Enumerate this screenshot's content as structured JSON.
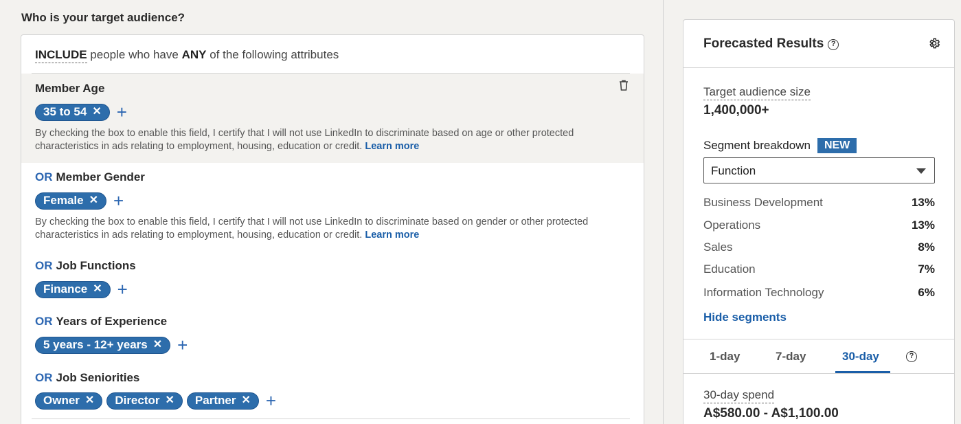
{
  "targeting": {
    "section_title": "Who is your target audience?",
    "include": {
      "keyword": "INCLUDE",
      "middle": "people who have",
      "any": "ANY",
      "end": "of the following attributes"
    },
    "or_label": "OR",
    "groups": [
      {
        "title": "Member Age",
        "pills": [
          "35 to 54"
        ],
        "disclaimer": "By checking the box to enable this field, I certify that I will not use LinkedIn to discriminate based on age or other protected characteristics in ads relating to employment, housing, education or credit.",
        "link": "Learn more"
      },
      {
        "title": "Member Gender",
        "pills": [
          "Female"
        ],
        "disclaimer": "By checking the box to enable this field, I certify that I will not use LinkedIn to discriminate based on gender or other protected characteristics in ads relating to employment, housing, education or credit.",
        "link": "Learn more"
      },
      {
        "title": "Job Functions",
        "pills": [
          "Finance"
        ]
      },
      {
        "title": "Years of Experience",
        "pills": [
          "5 years - 12+ years"
        ]
      },
      {
        "title": "Job Seniorities",
        "pills": [
          "Owner",
          "Director",
          "Partner"
        ]
      }
    ],
    "remove_glyph": "✕",
    "add_glyph": "+"
  },
  "forecast": {
    "title": "Forecasted Results",
    "help_glyph": "?",
    "audience_label": "Target audience size",
    "audience_value": "1,400,000+",
    "segment_label": "Segment breakdown",
    "new_badge": "NEW",
    "segment_select": "Function",
    "segments": [
      {
        "name": "Business Development",
        "pct": "13%"
      },
      {
        "name": "Operations",
        "pct": "13%"
      },
      {
        "name": "Sales",
        "pct": "8%"
      },
      {
        "name": "Education",
        "pct": "7%"
      },
      {
        "name": "Information Technology",
        "pct": "6%"
      }
    ],
    "hide_link": "Hide segments",
    "tabs": [
      "1-day",
      "7-day",
      "30-day"
    ],
    "active_tab": "30-day",
    "spend_label": "30-day spend",
    "spend_value": "A$580.00 - A$1,100.00"
  },
  "colors": {
    "accent": "#2d6dab",
    "link": "#1a5ea8",
    "background": "#f3f2ef"
  }
}
